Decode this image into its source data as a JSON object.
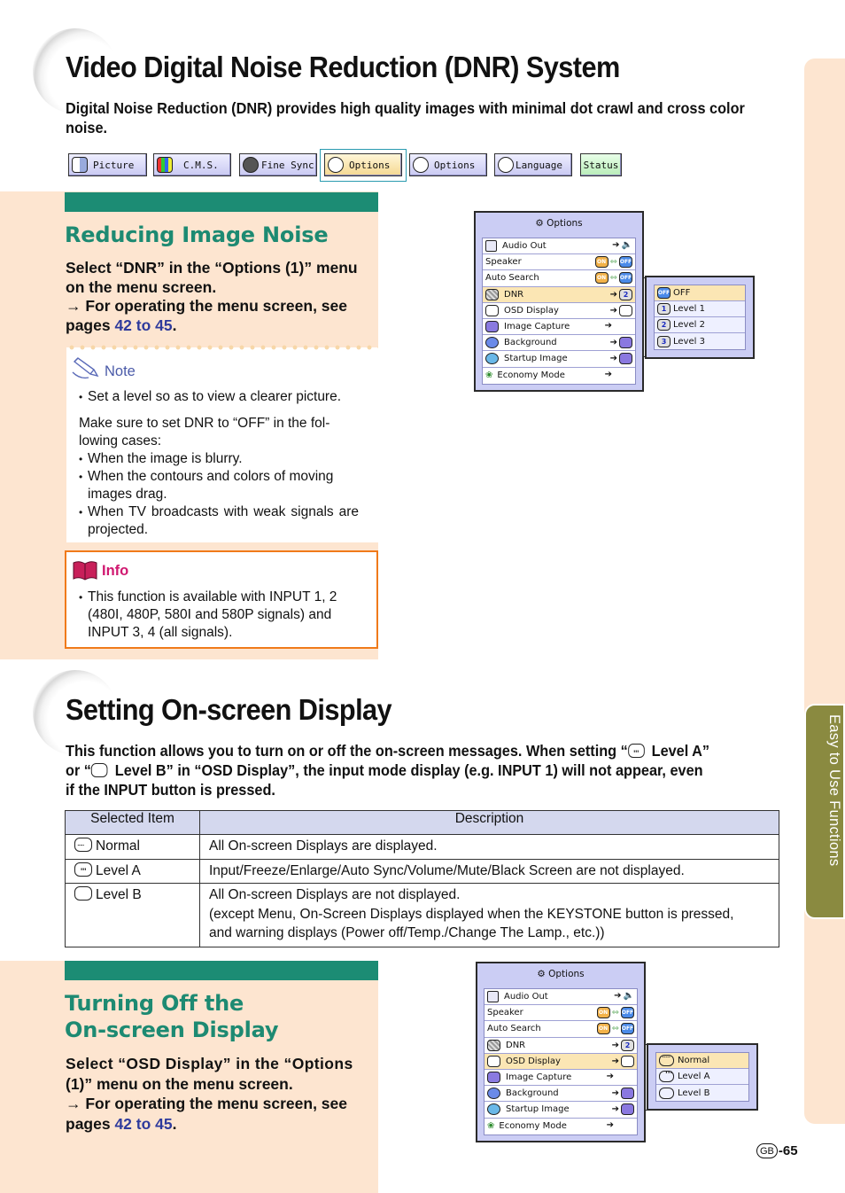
{
  "section1": {
    "title": "Video Digital Noise Reduction (DNR) System",
    "lead": "Digital Noise Reduction (DNR) provides high quality images with minimal dot crawl and cross color noise."
  },
  "tabs": [
    {
      "label": "Picture",
      "icon": "picture-icon",
      "active": false
    },
    {
      "label": "C.M.S.",
      "icon": "cms-icon",
      "active": false
    },
    {
      "label": "Fine Sync",
      "icon": "fine-sync-icon",
      "active": false
    },
    {
      "label": "Options",
      "icon": "options1-icon",
      "active": true
    },
    {
      "label": "Options",
      "icon": "options2-icon",
      "active": false
    },
    {
      "label": "Language",
      "icon": "language-icon",
      "active": false
    },
    {
      "label": "Status",
      "icon": "",
      "active": false
    }
  ],
  "reducing": {
    "heading": "Reducing Image Noise",
    "step_line1": "Select “DNR” in the “Options (1)” menu",
    "step_line2": "on the menu screen.",
    "step_line3": "→ For operating the menu screen, see",
    "step_pages_prefix": "pages ",
    "step_pages_link": "42 to 45",
    "step_pages_suffix": "."
  },
  "note": {
    "title": "Note",
    "bullet1": "Set a level so as to view a clearer picture.",
    "para": "Make sure to set DNR to “OFF” in the fol-lowing cases:",
    "cases": [
      "When the image is blurry.",
      "When the contours and colors of moving images drag.",
      "When TV broadcasts with weak signals are projected."
    ]
  },
  "info": {
    "title": "Info",
    "bullet": "This function is available with INPUT 1, 2 (480I, 480P, 580I and 580P signals) and INPUT 3, 4 (all signals)."
  },
  "menu_options": {
    "title": "Options",
    "rows": [
      {
        "label": "Audio Out",
        "value": "audio-out"
      },
      {
        "label": "Speaker",
        "value": "on-off",
        "on": "ON",
        "off": "OFF"
      },
      {
        "label": "Auto Search",
        "value": "on-off",
        "on": "ON",
        "off": "OFF"
      },
      {
        "label": "DNR",
        "value": "2"
      },
      {
        "label": "OSD Display",
        "value": "osd"
      },
      {
        "label": "Image Capture",
        "value": ""
      },
      {
        "label": "Background",
        "value": "bg"
      },
      {
        "label": "Startup Image",
        "value": "bg"
      },
      {
        "label": "Economy Mode",
        "value": ""
      }
    ]
  },
  "dnr_sub": {
    "items": [
      {
        "label": "OFF",
        "badge": "OFF"
      },
      {
        "label": "Level 1",
        "badge": "1"
      },
      {
        "label": "Level 2",
        "badge": "2"
      },
      {
        "label": "Level 3",
        "badge": "3"
      }
    ],
    "selected": "OFF"
  },
  "section2": {
    "title": "Setting On-screen Display",
    "lead1a": "This function allows you to turn on or off the on-screen messages. When setting “",
    "lead1b": " Level A”",
    "lead2a": "or “",
    "lead2b": " Level B” in “OSD Display”, the input mode display (e.g. INPUT 1) will not appear, even",
    "lead3": "if the INPUT button is pressed."
  },
  "osd_table": {
    "headers": [
      "Selected Item",
      "Description"
    ],
    "rows": [
      {
        "item": "Normal",
        "icon": "osd-normal-icon",
        "desc": [
          "All On-screen Displays are displayed."
        ]
      },
      {
        "item": "Level A",
        "icon": "osd-level-a-icon",
        "desc": [
          "Input/Freeze/Enlarge/Auto Sync/Volume/Mute/Black Screen are not displayed."
        ]
      },
      {
        "item": "Level B",
        "icon": "osd-level-b-icon",
        "desc": [
          "All On-screen Displays are not displayed.",
          "(except Menu, On-Screen Displays displayed when the KEYSTONE button is pressed,",
          "and warning displays (Power off/Temp./Change The Lamp., etc.))"
        ]
      }
    ]
  },
  "turning_off": {
    "heading_line1": "Turning Off the",
    "heading_line2": "On-screen Display",
    "step_line1": "Select “OSD Display” in the “Options",
    "step_line2": "(1)” menu on the menu screen.",
    "step_line3": "→ For operating the menu screen, see",
    "step_pages_prefix": "pages ",
    "step_pages_link": "42 to 45",
    "step_pages_suffix": "."
  },
  "osd_sub": {
    "items": [
      "Normal",
      "Level A",
      "Level B"
    ],
    "selected": "Normal"
  },
  "side_tab": {
    "label": "Easy to Use Functions"
  },
  "footer": {
    "region": "GB",
    "page": "-65"
  },
  "colors": {
    "accent_green": "#1c8c74",
    "link_blue": "#2e3a9c",
    "info_orange": "#f07a1a",
    "info_pink": "#d01870",
    "peach": "#fde5d0",
    "side_olive": "#8a8a40"
  }
}
